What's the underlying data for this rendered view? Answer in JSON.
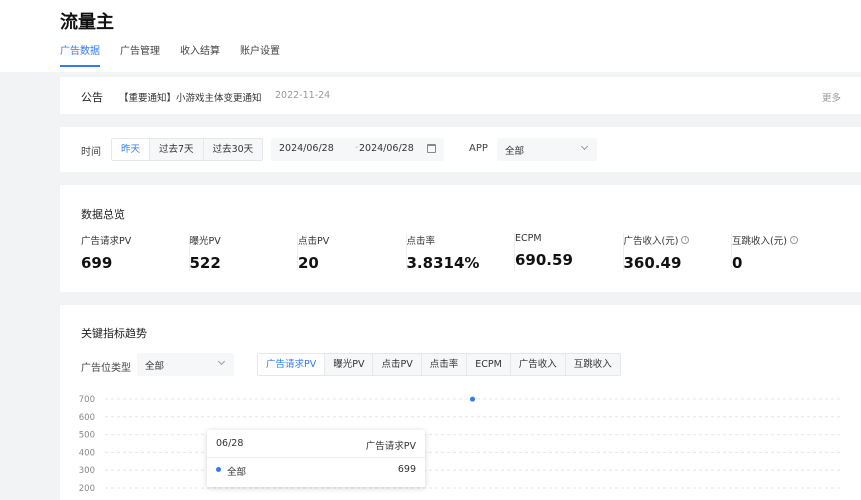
{
  "app": {
    "title": "流量主"
  },
  "tabs": [
    {
      "label": "广告数据",
      "active": true
    },
    {
      "label": "广告管理",
      "active": false
    },
    {
      "label": "收入结算",
      "active": false
    },
    {
      "label": "账户设置",
      "active": false
    }
  ],
  "notice": {
    "label": "公告",
    "text": "【重要通知】小游戏主体变更通知",
    "date": "2022-11-24",
    "more": "更多"
  },
  "filters": {
    "time_label": "时间",
    "time_options": [
      {
        "label": "昨天",
        "active": true
      },
      {
        "label": "过去7天",
        "active": false
      },
      {
        "label": "过去30天",
        "active": false
      }
    ],
    "date_start": "2024/06/28",
    "date_sep": "-",
    "date_end": "2024/06/28",
    "app_label": "APP",
    "app_value": "全部"
  },
  "overview": {
    "title": "数据总览",
    "metrics": [
      {
        "label": "广告请求PV",
        "value": "699",
        "info": false
      },
      {
        "label": "曝光PV",
        "value": "522",
        "info": false
      },
      {
        "label": "点击PV",
        "value": "20",
        "info": false
      },
      {
        "label": "点击率",
        "value": "3.8314%",
        "info": false
      },
      {
        "label": "ECPM",
        "value": "690.59",
        "info": false
      },
      {
        "label": "广告收入(元)",
        "value": "360.49",
        "info": true
      },
      {
        "label": "互跳收入(元)",
        "value": "0",
        "info": true
      }
    ]
  },
  "trend": {
    "title": "关键指标趋势",
    "slot_label": "广告位类型",
    "slot_value": "全部",
    "metric_tabs": [
      {
        "label": "广告请求PV",
        "active": true
      },
      {
        "label": "曝光PV",
        "active": false
      },
      {
        "label": "点击PV",
        "active": false
      },
      {
        "label": "点击率",
        "active": false
      },
      {
        "label": "ECPM",
        "active": false
      },
      {
        "label": "广告收入",
        "active": false
      },
      {
        "label": "互跳收入",
        "active": false
      }
    ],
    "tooltip": {
      "date": "06/28",
      "metric": "广告请求PV",
      "series": "全部",
      "value": "699"
    }
  },
  "chart_data": {
    "type": "scatter",
    "x": [
      "06/28"
    ],
    "series": [
      {
        "name": "全部",
        "values": [
          699
        ]
      }
    ],
    "yticks": [
      200,
      300,
      400,
      500,
      600,
      700
    ],
    "ylim": [
      200,
      700
    ],
    "grid": true,
    "colors": {
      "series": "#2e7cf6"
    }
  },
  "colors": {
    "accent": "#2e7cf6",
    "background": "#f2f3f5"
  }
}
